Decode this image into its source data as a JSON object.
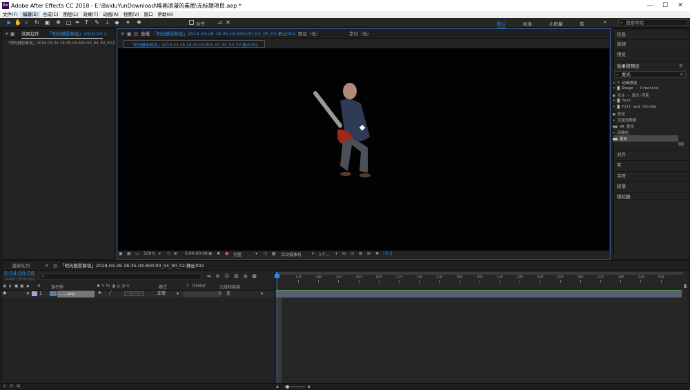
{
  "app": {
    "title": "Adobe After Effects CC 2018 - E:\\BaiduYunDownload\\堆画浪漫的素图\\无标题项目.aep *",
    "logo": "Ae"
  },
  "window_controls": {
    "minimize": "—",
    "maximize": "☐",
    "close": "✕"
  },
  "menu": [
    "文件(F)",
    "编辑(E)",
    "合成(C)",
    "图层(L)",
    "效果(T)",
    "动画(A)",
    "视图(V)",
    "窗口",
    "帮助(H)"
  ],
  "toolbar": {
    "align_label": "对齐",
    "workspaces": [
      "默认",
      "标准",
      "小屏幕",
      "库"
    ],
    "search_placeholder": "搜索帮助"
  },
  "left_panel": {
    "tab": "效果控件",
    "tab_layer": "「明光魅影解说」2019-03-2",
    "menu": "≡",
    "row": "「明光魅影解说」2019-03-26 18-35-04-600.00_04_00_02.静"
  },
  "comp_panel": {
    "tab_prefix": "合成",
    "tab_name": "「明光魅影解说」2019-03-26 18-35-04-600.00_04_00_02.静止002",
    "layer_tab": "图层（无）",
    "footage_tab": "素材（无）",
    "sub_tab": "「明光魅影解说」2019-03-26 18-35-04-600.00_04_00_02.静止002"
  },
  "viewer_controls": {
    "zoom": "100%",
    "timecode": "0:04:00:08",
    "resolution": "完整",
    "camera": "活动摄像机",
    "views": "1个...",
    "exposure": "+0.0"
  },
  "right_panel": {
    "items_top": [
      "信息",
      "音频",
      "预览"
    ],
    "effects_title": "效果和预设",
    "search_value": "发光",
    "tree": [
      "▾ * 动画预设",
      "  ▾ ▇ Image - Creative",
      "      ▣ 光斗 - 发光-闪影",
      "  ▾ ▇ Text",
      "    ▾ ▇ Fill and Stroke",
      "        ▣ 发光",
      "▾ 沉浸式视频",
      "   ▣▣ VR 发光",
      "▾ 风格化",
      "   ▣▣ 发光"
    ],
    "items_bottom": [
      "对齐",
      "库",
      "字符",
      "段落",
      "跟踪器"
    ]
  },
  "timeline": {
    "render_tab": "渲染队列",
    "comp_tab": "「明光魅影解说」2019-03-26 18-35-04-600.00_04_00_02.静止002",
    "timecode": "0:04:00:08",
    "fps": "14408 (30.00 fps)",
    "search_icon": "⌕",
    "columns": {
      "name": "源名称",
      "mode": "模式",
      "trkmat": "TrkMat",
      "parent": "父级和链接",
      "t": "T",
      "num": "#"
    },
    "layer": {
      "num": "1",
      "name": "…….png",
      "mode": "正常",
      "parent": "无"
    },
    "ruler": [
      "12f",
      "18f",
      "24f",
      "00f",
      "06f",
      "12f",
      "18f",
      "24f",
      "00f",
      "06f",
      "12f",
      "18f",
      "24f",
      "00f",
      "06f",
      "12f",
      "18f",
      "24f",
      "00f"
    ]
  },
  "colors": {
    "accent": "#2d8ceb",
    "panel": "#232323",
    "bg": "#1d1d1d",
    "viewer": "#020202"
  }
}
